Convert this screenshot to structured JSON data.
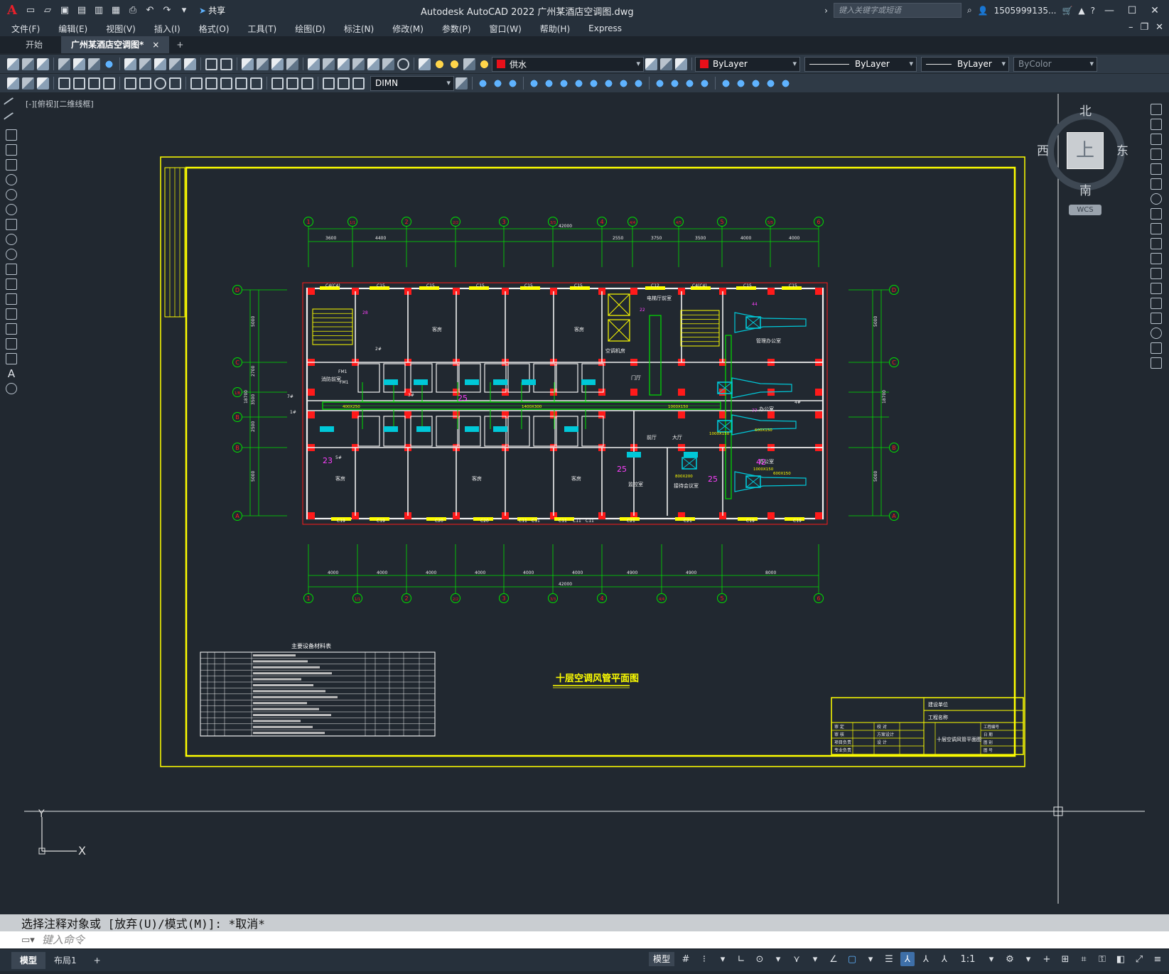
{
  "app": {
    "logo": "A",
    "title": "Autodesk AutoCAD 2022    广州某酒店空调图.dwg",
    "share_label": "共享",
    "search_placeholder": "键入关键字或短语",
    "user": "1505999135...",
    "window_controls": [
      "minimize-icon",
      "maximize-icon",
      "close-icon"
    ]
  },
  "menu": {
    "items": [
      "文件(F)",
      "编辑(E)",
      "视图(V)",
      "插入(I)",
      "格式(O)",
      "工具(T)",
      "绘图(D)",
      "标注(N)",
      "修改(M)",
      "参数(P)",
      "窗口(W)",
      "帮助(H)",
      "Express"
    ]
  },
  "tabs": {
    "items": [
      {
        "label": "开始",
        "active": false
      },
      {
        "label": "广州某酒店空调图*",
        "active": true
      }
    ],
    "close_glyph": "×",
    "add_glyph": "+"
  },
  "toolbar": {
    "layer": "供水",
    "layer_color": "#e8101a",
    "color": "ByLayer",
    "linetype": "ByLayer",
    "lineweight": "ByLayer",
    "plotstyle": "ByColor",
    "dimstyle": "DIMN"
  },
  "viewport": {
    "label": "[-][俯视][二维线框]",
    "viewcube": {
      "face": "上",
      "north": "北",
      "south": "南",
      "east": "东",
      "west": "西",
      "wcs": "WCS"
    },
    "ucs": {
      "x": "X",
      "y": "Y"
    }
  },
  "drawing": {
    "title": "十层空调风管平面图",
    "table_title": "主要设备材料表",
    "top_axes": [
      "1",
      "1/1",
      "2",
      "2/2",
      "3",
      "3/3",
      "4",
      "4/4",
      "4/5",
      "5",
      "5/5",
      "6"
    ],
    "bottom_axes": [
      "1",
      "1/1",
      "2",
      "2/2",
      "3",
      "3/3",
      "4",
      "4/4",
      "5",
      "6"
    ],
    "side_axes": [
      "D",
      "C",
      "1/B",
      "B",
      "B",
      "A"
    ],
    "top_dims": [
      "3600",
      "4400",
      "2550",
      "3750",
      "3500",
      "4000",
      "4000"
    ],
    "top_total": "42000",
    "bottom_dims": [
      "4000",
      "4000",
      "4000",
      "4000",
      "4000",
      "4000",
      "4900",
      "4900",
      "8000"
    ],
    "bottom_total": "42000",
    "side_dims": [
      "5000",
      "2700",
      "3500",
      "2500",
      "5000"
    ],
    "side_total": "18700",
    "room_labels": [
      "客房",
      "客房",
      "客房",
      "客房",
      "客房",
      "消防前室",
      "电梯厅前室",
      "空调机房",
      "门厅",
      "管理办公室",
      "办公室",
      "办公室",
      "监控室",
      "接待会议室",
      "前厅",
      "大厅"
    ],
    "window_labels": [
      "C4(C4)",
      "C15",
      "C15",
      "C15",
      "C15",
      "C15",
      "C12",
      "C4(C4)",
      "C15",
      "C15",
      "C19",
      "C19",
      "C20",
      "C20",
      "C11",
      "C11",
      "C11",
      "C11",
      "C11",
      "C21",
      "C21",
      "C19",
      "C19"
    ],
    "duct_labels": [
      "400X250",
      "1400X300",
      "1000X150",
      "600X150",
      "1000X150",
      "600X150",
      "1000X150",
      "800X200"
    ],
    "tag_numbers": [
      "23",
      "25",
      "25",
      "25",
      "42",
      "77",
      "44",
      "22",
      "28"
    ],
    "equipment_tags": [
      "FM1",
      "FM1",
      "2#",
      "3#",
      "5#",
      "7#",
      "1#",
      "4#"
    ],
    "title_block": {
      "org": "建设单位",
      "project": "工程名称",
      "drawing_name": "十层空调风管平面图",
      "roles": [
        "审 定",
        "审 核",
        "项目负责",
        "专业负责",
        "校 对",
        "方案设计",
        "设 计"
      ],
      "fields": [
        "工程编号",
        "日 期",
        "图 别",
        "图 号"
      ]
    }
  },
  "command": {
    "history": "选择注释对象或 [放弃(U)/模式(M)]: *取消*",
    "placeholder": "键入命令"
  },
  "status": {
    "layout_tabs": [
      {
        "label": "模型",
        "active": true
      },
      {
        "label": "布局1",
        "active": false
      }
    ],
    "add_glyph": "+",
    "model_label": "模型",
    "scale": "1:1"
  }
}
